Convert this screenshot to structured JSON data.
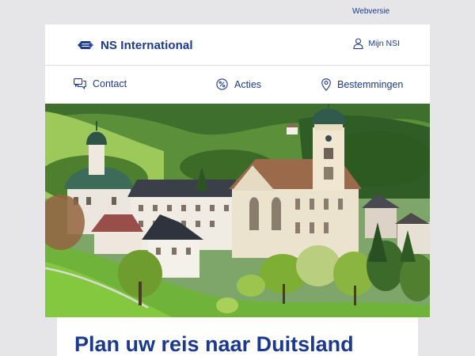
{
  "topbar": {
    "webversion_label": "Webversie"
  },
  "brand": {
    "name": "NS International",
    "color": "#1b3a8f"
  },
  "account": {
    "label": "Mijn NSI",
    "icon": "user-icon"
  },
  "nav": [
    {
      "label": "Contact",
      "icon": "chat-icon"
    },
    {
      "label": "Acties",
      "icon": "percent-icon"
    },
    {
      "label": "Bestemmingen",
      "icon": "location-pin-icon"
    }
  ],
  "hero": {
    "description": "Black Forest village with abbey church and green hills"
  },
  "headline": "Plan uw reis naar Duitsland",
  "colors": {
    "accent": "#1b3a8f",
    "background": "#e6e6e9",
    "card": "#ffffff"
  }
}
